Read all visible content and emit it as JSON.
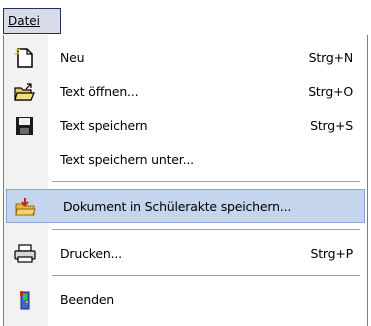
{
  "menubar": {
    "menu_label": "Datei"
  },
  "menu": {
    "items": [
      {
        "label": "Neu",
        "shortcut": "Strg+N",
        "icon": "new-document-icon"
      },
      {
        "label": "Text öffnen...",
        "shortcut": "Strg+O",
        "icon": "open-folder-icon"
      },
      {
        "label": "Text speichern",
        "shortcut": "Strg+S",
        "icon": "save-disk-icon"
      },
      {
        "label": "Text speichern unter...",
        "shortcut": "",
        "icon": ""
      },
      {
        "label": "Dokument in Schülerakte speichern...",
        "shortcut": "",
        "icon": "student-file-save-icon"
      },
      {
        "label": "Drucken...",
        "shortcut": "Strg+P",
        "icon": "printer-icon"
      },
      {
        "label": "Beenden",
        "shortcut": "",
        "icon": "exit-icon"
      }
    ]
  }
}
